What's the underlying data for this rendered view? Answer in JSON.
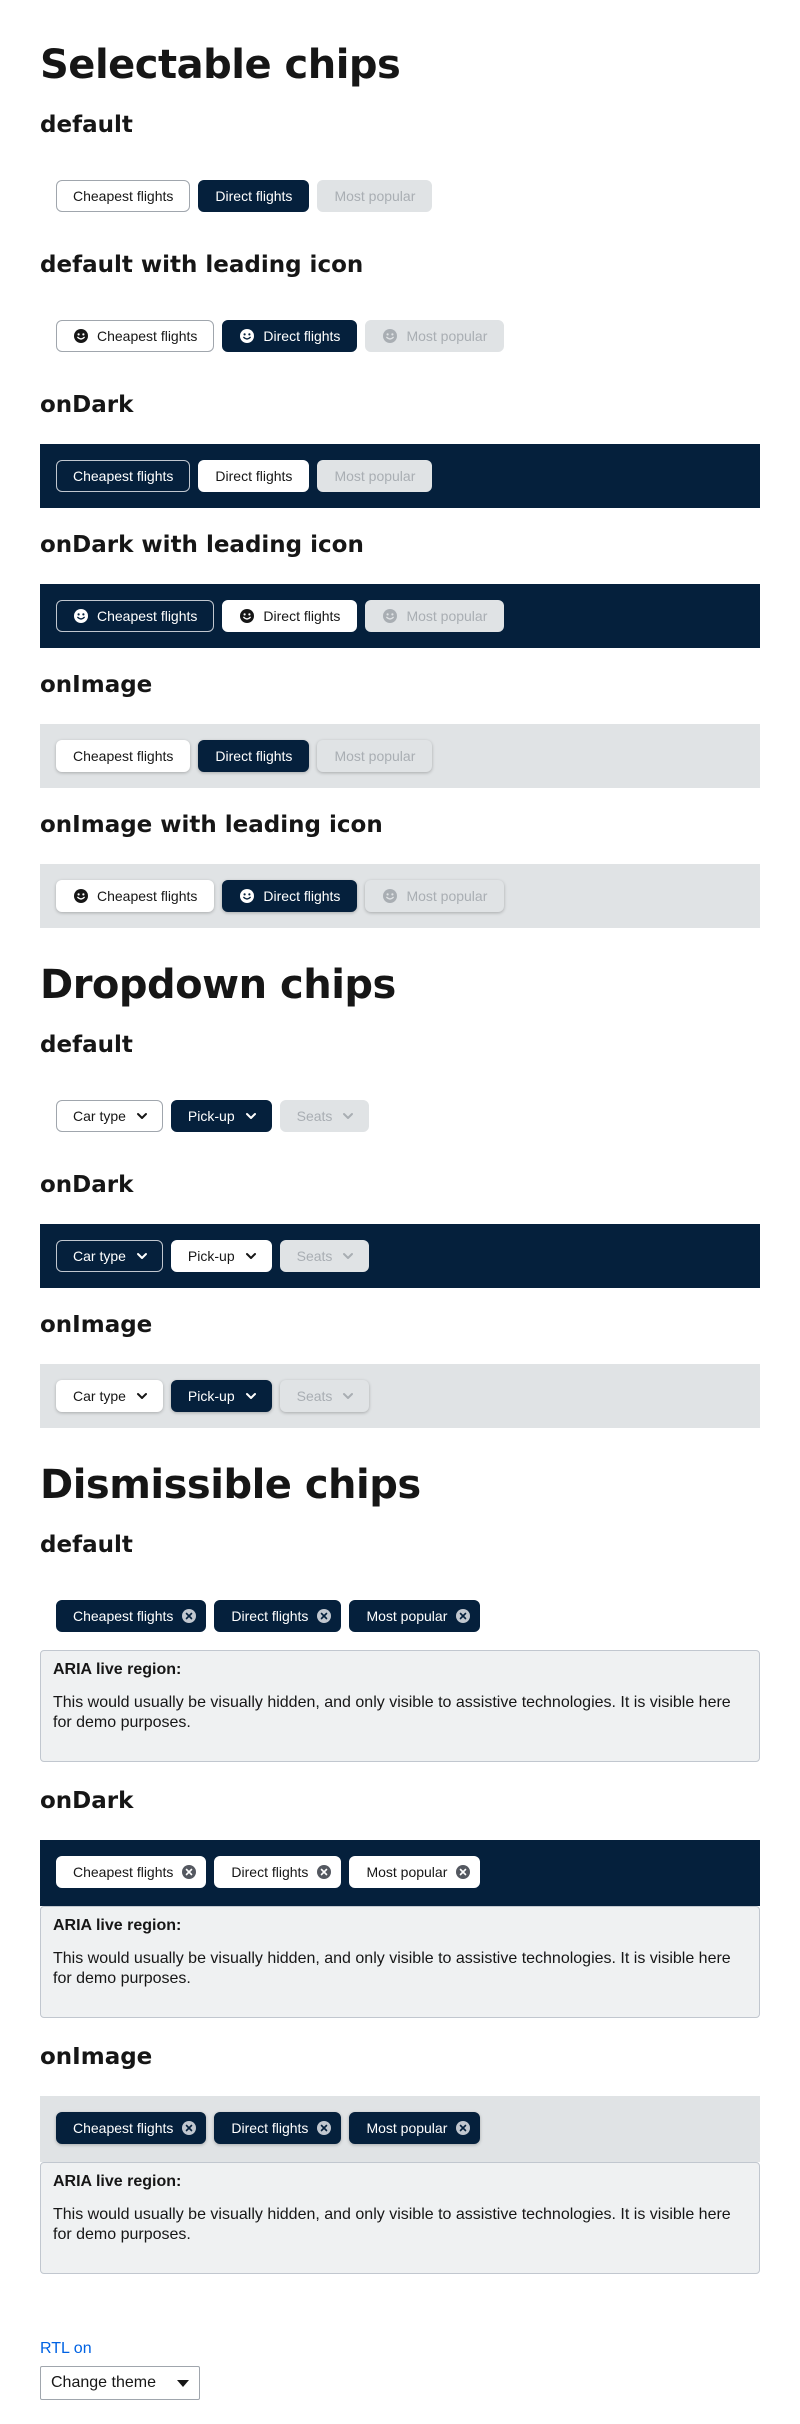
{
  "selectable": {
    "title": "Selectable chips",
    "chips": [
      "Cheapest flights",
      "Direct flights",
      "Most popular"
    ],
    "variants": {
      "default": "default",
      "default_icon": "default with leading icon",
      "ondark": "onDark",
      "ondark_icon": "onDark with leading icon",
      "onimage": "onImage",
      "onimage_icon": "onImage with leading icon"
    },
    "leading_icon": "smiley-face-icon"
  },
  "dropdown": {
    "title": "Dropdown chips",
    "chips": [
      "Car type",
      "Pick-up",
      "Seats"
    ],
    "variants": {
      "default": "default",
      "ondark": "onDark",
      "onimage": "onImage"
    },
    "trailing_icon": "chevron-down-icon"
  },
  "dismissible": {
    "title": "Dismissible chips",
    "chips": [
      "Cheapest flights",
      "Direct flights",
      "Most popular"
    ],
    "variants": {
      "default": "default",
      "ondark": "onDark",
      "onimage": "onImage"
    },
    "trailing_icon": "close-circle-icon",
    "aria": {
      "title": "ARIA live region:",
      "body": "This would usually be visually hidden, and only visible to assistive technologies. It is visible here for demo purposes."
    }
  },
  "footer": {
    "rtl_link": "RTL on",
    "theme_select": "Change theme"
  },
  "colors": {
    "dark_band": "#05203c",
    "image_band": "#e0e3e5",
    "disabled_text": "#a9aeb3",
    "link": "#0062e3",
    "aria_bg": "#eff1f2"
  }
}
